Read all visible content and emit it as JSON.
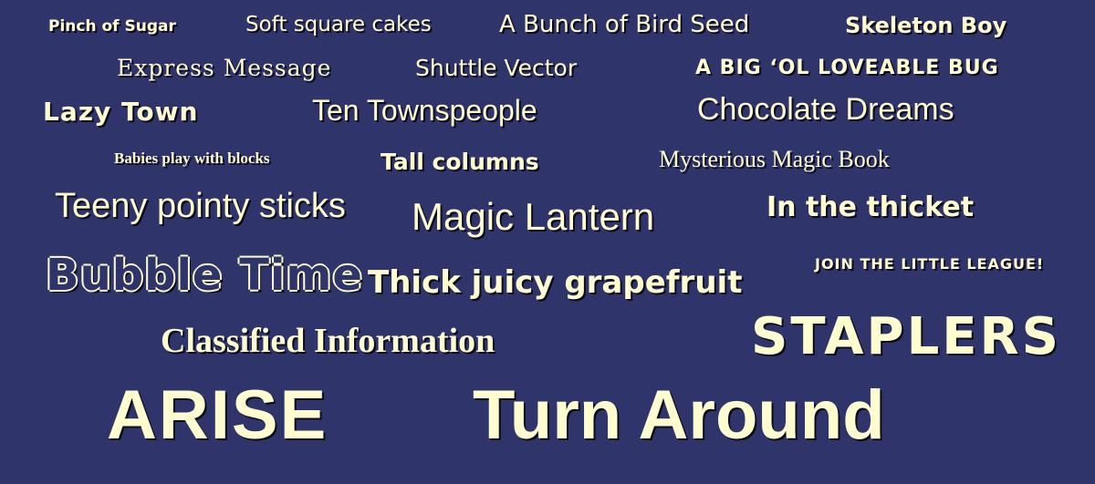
{
  "theme": {
    "background": "#2f346b",
    "text_color": "#fffdd0",
    "shadow_color": "#0b0b1a"
  },
  "labels": [
    "Pinch of Sugar",
    "Soft square cakes",
    "A Bunch of Bird Seed",
    "Skeleton Boy",
    "Express Message",
    "Shuttle Vector",
    "A BIG ‘OL LOVEABLE BUG",
    "Lazy Town",
    "Ten Townspeople",
    "Chocolate Dreams",
    "Babies play with blocks",
    "Tall columns",
    "Mysterious Magic Book",
    "Teeny pointy sticks",
    "Magic Lantern",
    "In the thicket",
    "Bubble Time",
    "Thick juicy grapefruit",
    "JOIN THE LITTLE LEAGUE!",
    "Classified Information",
    "STAPLERS",
    "ARISE",
    "Turn Around"
  ]
}
